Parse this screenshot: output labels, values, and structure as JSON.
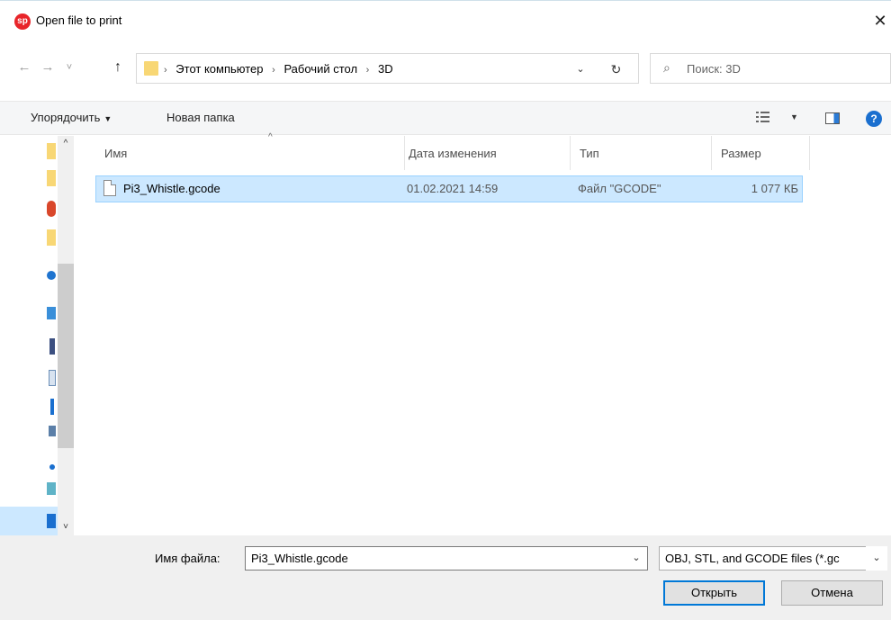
{
  "window": {
    "title": "Open file to print",
    "app_icon_text": "sp",
    "close_glyph": "✕"
  },
  "nav": {
    "back_glyph": "←",
    "forward_glyph": "→",
    "recent_glyph": "˅",
    "up_glyph": "↑",
    "breadcrumbs": [
      "Этот компьютер",
      "Рабочий стол",
      "3D"
    ],
    "crumb_separator": "›",
    "dropdown_glyph": "⌄",
    "refresh_glyph": "↻",
    "search_placeholder": "Поиск: 3D",
    "search_glyph": "⌕"
  },
  "toolbar": {
    "organize_label": "Упорядочить",
    "new_folder_label": "Новая папка",
    "caret": "▼",
    "help_glyph": "?"
  },
  "columns": {
    "name": "Имя",
    "date": "Дата изменения",
    "type": "Тип",
    "size": "Размер",
    "sort_glyph": "^"
  },
  "files": [
    {
      "name": "Pi3_Whistle.gcode",
      "date": "01.02.2021 14:59",
      "type": "Файл \"GCODE\"",
      "size": "1 077 КБ"
    }
  ],
  "navpane": {
    "scroll_up": "^",
    "scroll_down": "˅"
  },
  "bottom": {
    "filename_label": "Имя файла:",
    "filename_value": "Pi3_Whistle.gcode",
    "filter_value": "OBJ, STL, and GCODE files (*.gc",
    "open_label": "Открыть",
    "cancel_label": "Отмена"
  },
  "colors": {
    "selection": "#cce8ff",
    "selection_border": "#99d1ff",
    "accent": "#0078d7",
    "folder": "#f8d775"
  }
}
